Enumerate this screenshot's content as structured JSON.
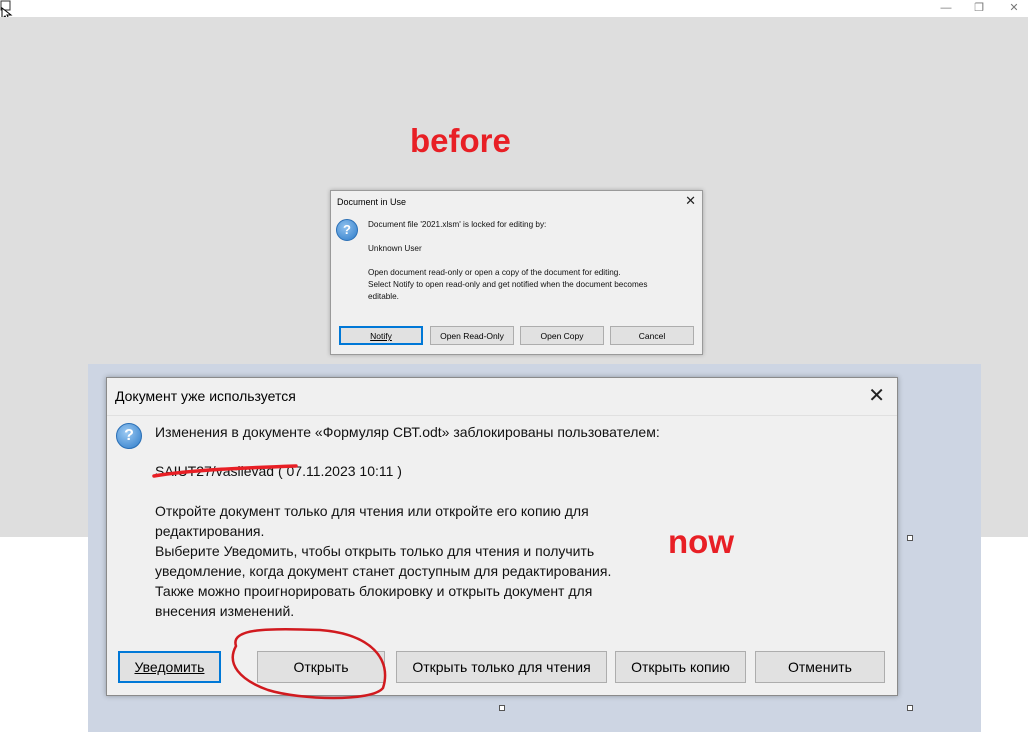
{
  "window": {
    "minimize": "—",
    "restore": "❐",
    "close": "✕"
  },
  "annotations": {
    "before": "before",
    "now": "now"
  },
  "dialog_old": {
    "title": "Document in Use",
    "close": "✕",
    "icon": "question-icon",
    "lines": [
      "Document file '2021.xlsm' is locked for editing by:",
      "Unknown User",
      "Open document read-only or open a copy of the document for editing.",
      "Select Notify to open read-only and get notified when the document becomes",
      "editable."
    ],
    "buttons": [
      "Notify",
      "Open Read-Only",
      "Open Copy",
      "Cancel"
    ]
  },
  "dialog_new": {
    "title": "Документ уже используется",
    "close": "✕",
    "icon": "question-icon",
    "intro": "Изменения в документе «Формуляр СВТ.odt» заблокированы пользователем:",
    "user": "SAIUT27/vasilevad",
    "timestamp": "( 07.11.2023 10:11 )",
    "lines": [
      "Откройте документ только для чтения или откройте его копию для",
      "редактирования.",
      "Выберите Уведомить, чтобы открыть только для чтения и получить",
      "уведомление, когда документ станет доступным для редактирования.",
      "Также можно проигнорировать блокировку и открыть документ для",
      "внесения изменений."
    ],
    "buttons": [
      "Уведомить",
      "Открыть",
      "Открыть только для чтения",
      "Открыть копию",
      "Отменить"
    ]
  },
  "colors": {
    "annotation": "#e81f25",
    "accent": "#0078d7",
    "workspace": "#dedede",
    "panel": "#cdd5e3"
  }
}
